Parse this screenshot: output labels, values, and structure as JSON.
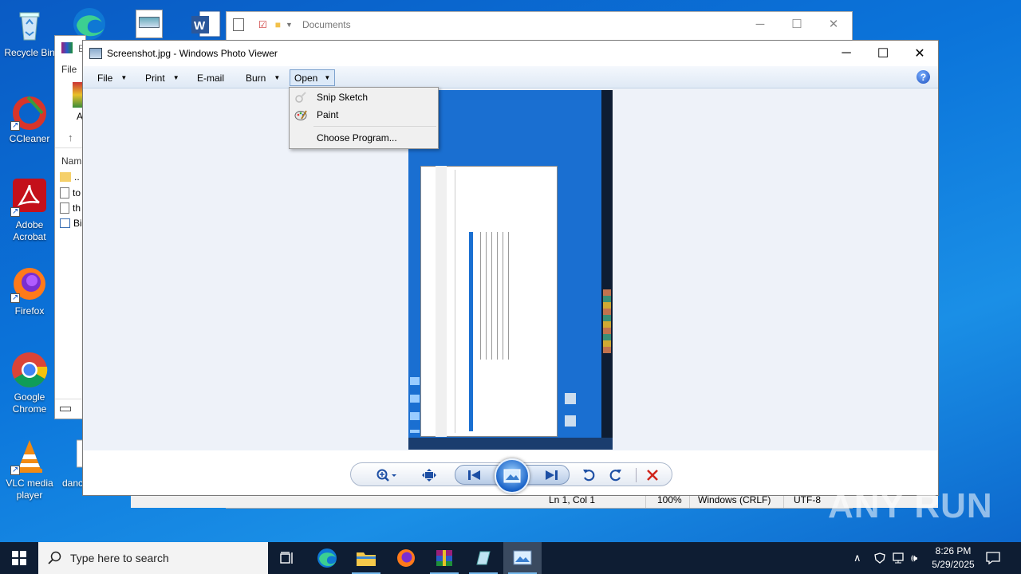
{
  "desktop": {
    "icons": [
      {
        "label": "Recycle Bin",
        "icon": "recycle-bin-icon"
      },
      {
        "label": "CCleaner",
        "icon": "ccleaner-icon"
      },
      {
        "label": "Adobe Acrobat",
        "icon": "acrobat-icon"
      },
      {
        "label": "Firefox",
        "icon": "firefox-icon"
      },
      {
        "label": "Google Chrome",
        "icon": "chrome-icon"
      },
      {
        "label": "VLC media player",
        "icon": "vlc-icon"
      },
      {
        "label": "danc",
        "icon": "file-icon"
      }
    ]
  },
  "background_window": {
    "title": "Documents",
    "status": {
      "position": "Ln 1, Col 1",
      "zoom": "100%",
      "line_ending": "Windows (CRLF)",
      "encoding": "UTF-8"
    }
  },
  "explorer_partial": {
    "menu_file": "File",
    "col_name": "Nam",
    "rows": [
      "..",
      "to",
      "th",
      "Bi"
    ],
    "letter_e": "E",
    "letter_a": "A"
  },
  "photo_viewer": {
    "title": "Screenshot.jpg - Windows Photo Viewer",
    "menu": {
      "file": "File",
      "print": "Print",
      "email": "E-mail",
      "burn": "Burn",
      "open": "Open"
    },
    "help": "?",
    "open_menu": {
      "items": [
        {
          "label": "Snip  Sketch",
          "icon": "snip-sketch-icon"
        },
        {
          "label": "Paint",
          "icon": "paint-icon"
        },
        {
          "label": "Choose Program...",
          "icon": ""
        }
      ]
    }
  },
  "taskbar": {
    "search_placeholder": "Type here to search",
    "time": "8:26 PM",
    "date": "5/29/2025"
  },
  "watermark": "ANY RUN",
  "colors": {
    "desktop_blue": "#0b74da",
    "taskbar": "#0e1d33",
    "menu_highlight": "#dce9f8"
  }
}
